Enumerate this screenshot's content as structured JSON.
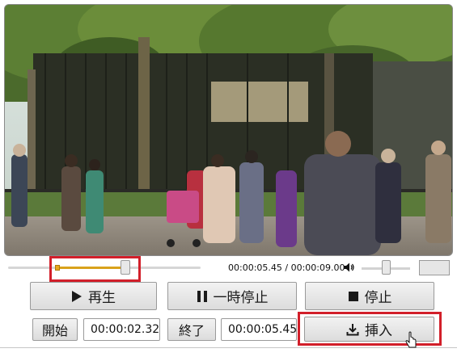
{
  "player": {
    "time_readout": "00:00:05.45 / 00:00:09.00",
    "trim_start_fraction": 0.26,
    "trim_end_fraction": 0.61,
    "volume_fraction": 0.45
  },
  "controls": {
    "play_label": "再生",
    "pause_label": "一時停止",
    "stop_label": "停止",
    "start_button_label": "開始",
    "start_time_value": "00:00:02.32",
    "end_button_label": "終了",
    "end_time_value": "00:00:05.45",
    "insert_label": "挿入"
  },
  "icons": {
    "play": "play-icon",
    "pause": "pause-icon",
    "stop": "stop-icon",
    "insert": "download-icon",
    "volume": "speaker-icon"
  },
  "colors": {
    "highlight": "#d21f2a",
    "trim_range": "#d9a21b"
  }
}
